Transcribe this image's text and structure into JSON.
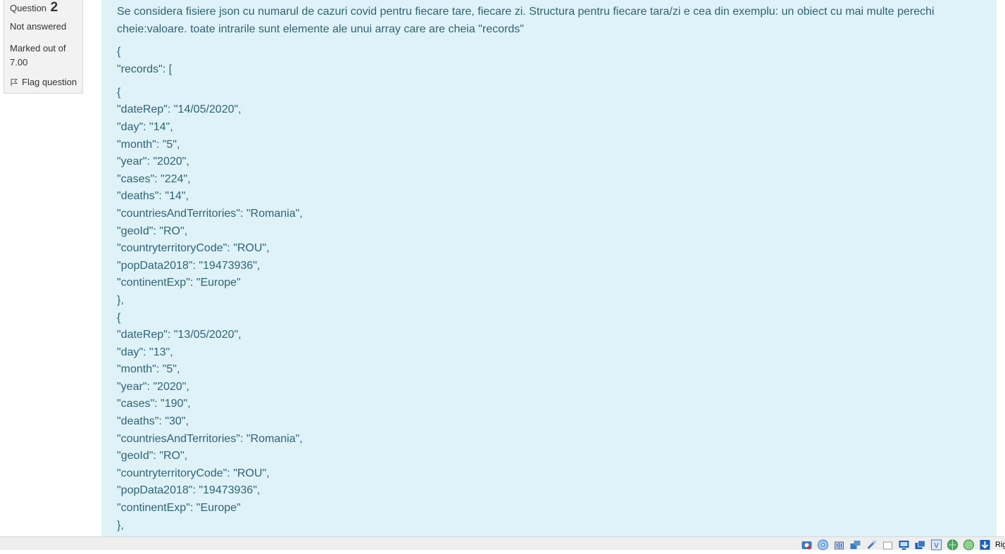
{
  "question_info": {
    "label": "Question",
    "number": "2",
    "state": "Not answered",
    "grade": "Marked out of 7.00",
    "flag_label": "Flag question"
  },
  "question_text": {
    "intro": "Se considera fisiere json cu numarul de cazuri covid pentru fiecare tare, fiecare zi. Structura pentru fiecare tara/zi e cea din exemplu: un obiect cu mai multe perechi cheie:valoare. toate intrarile sunt elemente ale unui array care are cheia \"records\"",
    "json_lines": [
      "{",
      "\"records\": [",
      "",
      "{",
      "\"dateRep\": \"14/05/2020\",",
      "\"day\": \"14\",",
      "\"month\": \"5\",",
      "\"year\": \"2020\",",
      "\"cases\": \"224\",",
      "\"deaths\": \"14\",",
      "\"countriesAndTerritories\": \"Romania\",",
      "\"geoId\": \"RO\",",
      "\"countryterritoryCode\": \"ROU\",",
      "\"popData2018\": \"19473936\",",
      "\"continentExp\": \"Europe\"",
      "},",
      "{",
      "\"dateRep\": \"13/05/2020\",",
      "\"day\": \"13\",",
      "\"month\": \"5\",",
      "\"year\": \"2020\",",
      "\"cases\": \"190\",",
      "\"deaths\": \"30\",",
      "\"countriesAndTerritories\": \"Romania\",",
      "\"geoId\": \"RO\",",
      "\"countryterritoryCode\": \"ROU\",",
      "\"popData2018\": \"19473936\",",
      "\"continentExp\": \"Europe\"",
      "},"
    ]
  },
  "statusbar": {
    "label": "Right Ctrl",
    "icons": [
      "hard-disk-icon",
      "optical-drive-icon",
      "audio-icon",
      "network-icon",
      "usb-icon",
      "shared-folders-icon",
      "display-icon",
      "video-capture-icon",
      "mouse-integration-icon",
      "virtualbox-icon",
      "globe-icon",
      "download-icon"
    ]
  },
  "colors": {
    "panel_bg": "#def2f8",
    "text": "#2f6473",
    "info_bg": "#f2f2f2"
  }
}
